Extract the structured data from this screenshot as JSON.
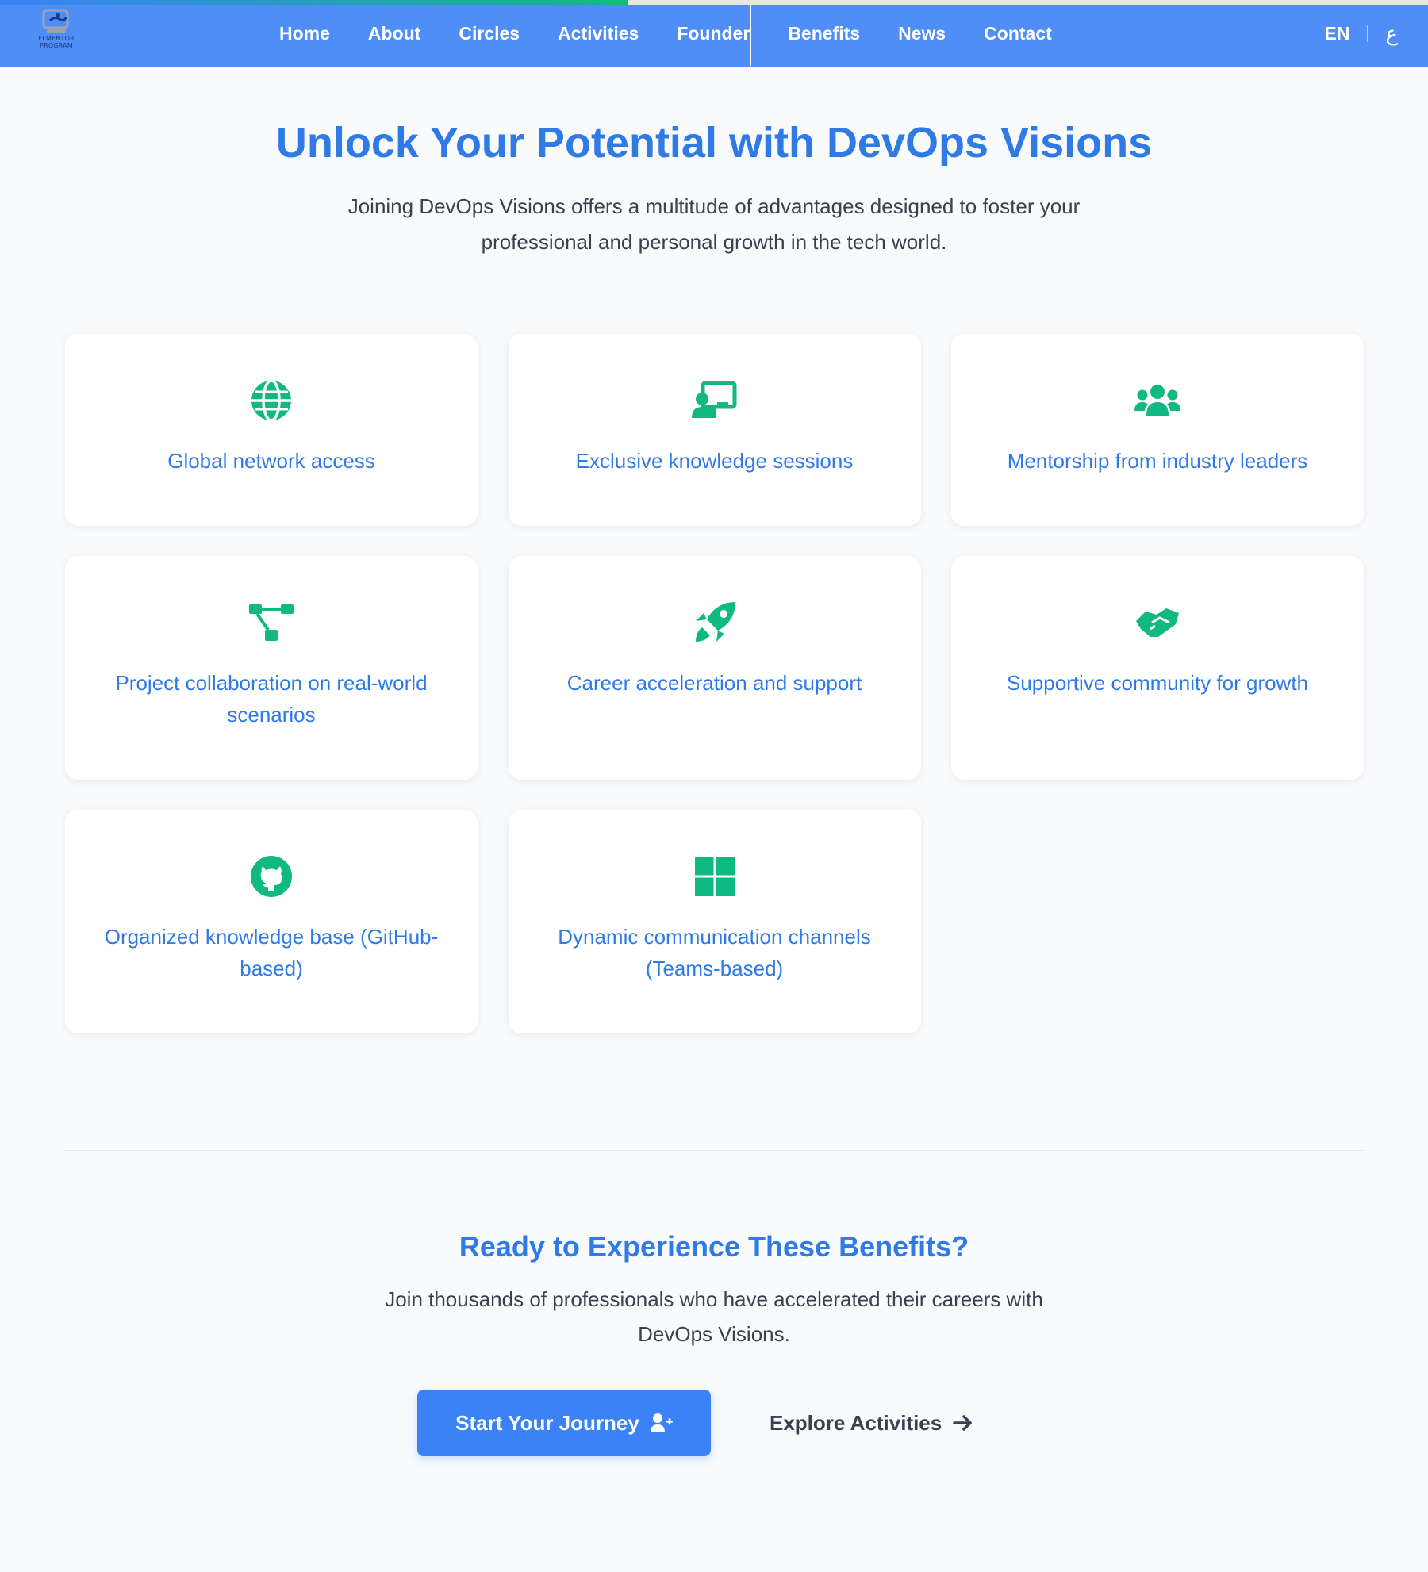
{
  "nav": {
    "logo_text_line1": "ELMENTOR",
    "logo_text_line2": "PROGRAM",
    "links": [
      "Home",
      "About",
      "Circles",
      "Activities",
      "Founder",
      "Benefits",
      "News",
      "Contact"
    ],
    "lang_en": "EN",
    "lang_ar": "ع"
  },
  "scroll_progress_percent": 44,
  "hero": {
    "title": "Unlock Your Potential with DevOps Visions",
    "subtitle": "Joining DevOps Visions offers a multitude of advantages designed to foster your professional and personal growth in the tech world."
  },
  "benefits": [
    {
      "icon": "globe-icon",
      "title": "Global network access"
    },
    {
      "icon": "chalkboard-teacher-icon",
      "title": "Exclusive knowledge sessions"
    },
    {
      "icon": "users-icon",
      "title": "Mentorship from industry leaders"
    },
    {
      "icon": "project-diagram-icon",
      "title": "Project collaboration on real-world scenarios"
    },
    {
      "icon": "rocket-icon",
      "title": "Career acceleration and support"
    },
    {
      "icon": "handshake-icon",
      "title": "Supportive community for growth"
    },
    {
      "icon": "github-icon",
      "title": "Organized knowledge base (GitHub-based)"
    },
    {
      "icon": "windows-icon",
      "title": "Dynamic communication channels (Teams-based)"
    }
  ],
  "cta": {
    "title": "Ready to Experience These Benefits?",
    "text": "Join thousands of professionals who have accelerated their careers with DevOps Visions.",
    "primary_button": "Start Your Journey",
    "secondary_button": "Explore Activities"
  },
  "colors": {
    "nav_bg": "#4f8ef7",
    "accent_blue": "#2f7ae5",
    "icon_green": "#10b981",
    "button_blue": "#3b82f6",
    "page_bg": "#f8fafc"
  }
}
